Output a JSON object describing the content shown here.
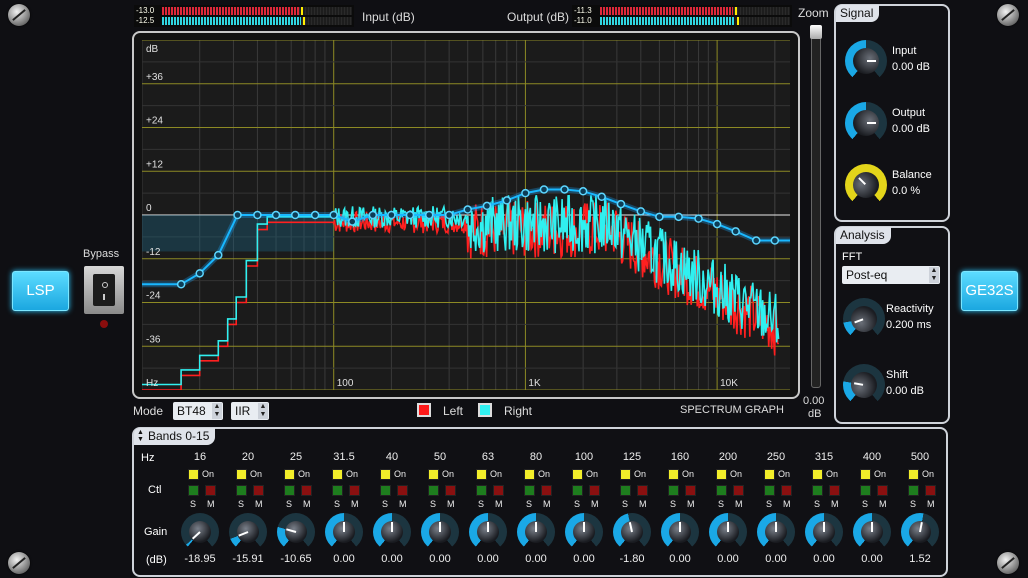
{
  "colors": {
    "accent": "#1ab4f0",
    "graph_bg": "#1a1a1a",
    "curve": "#19b7ff",
    "left": "#ff2020",
    "right": "#30f0f0"
  },
  "buttons": {
    "lsp": "LSP",
    "ge32s": "GE32S"
  },
  "bypass": {
    "label": "Bypass"
  },
  "meters": {
    "input": {
      "label": "Input (dB)",
      "l": "-13.0",
      "r": "-12.5",
      "level_l": 0.72,
      "level_r": 0.73
    },
    "output": {
      "label": "Output (dB)",
      "l": "-11.3",
      "r": "-11.0",
      "level_l": 0.7,
      "level_r": 0.71
    }
  },
  "graph": {
    "db_unit": "dB",
    "hz_unit": "Hz",
    "y_ticks": [
      "+36",
      "+24",
      "+12",
      "0",
      "-12",
      "-24",
      "-36"
    ],
    "x_ticks": [
      "100",
      "1K",
      "10K"
    ],
    "title": "SPECTRUM GRAPH"
  },
  "zoom": {
    "label": "Zoom",
    "value": "0.00",
    "unit": "dB"
  },
  "mode": {
    "label": "Mode",
    "filter": "BT48",
    "type": "IIR"
  },
  "legend": {
    "left": "Left",
    "right": "Right"
  },
  "signal": {
    "title": "Signal",
    "input": {
      "label": "Input",
      "value": "0.00 dB"
    },
    "output": {
      "label": "Output",
      "value": "0.00 dB"
    },
    "balance": {
      "label": "Balance",
      "value": "0.0 %"
    }
  },
  "analysis": {
    "title": "Analysis",
    "fft_label": "FFT",
    "fft_value": "Post-eq",
    "reactivity": {
      "label": "Reactivity",
      "value": "0.200 ms"
    },
    "shift": {
      "label": "Shift",
      "value": "0.00 dB"
    }
  },
  "bands": {
    "title": "Bands 0-15",
    "hz_label": "Hz",
    "ctl_label": "Ctl",
    "gain_label": "Gain",
    "db_label": "(dB)",
    "on_label": "On",
    "s_label": "S",
    "m_label": "M",
    "items": [
      {
        "freq": "16",
        "gain": "-18.95"
      },
      {
        "freq": "20",
        "gain": "-15.91"
      },
      {
        "freq": "25",
        "gain": "-10.65"
      },
      {
        "freq": "31.5",
        "gain": "0.00"
      },
      {
        "freq": "40",
        "gain": "0.00"
      },
      {
        "freq": "50",
        "gain": "0.00"
      },
      {
        "freq": "63",
        "gain": "0.00"
      },
      {
        "freq": "80",
        "gain": "0.00"
      },
      {
        "freq": "100",
        "gain": "0.00"
      },
      {
        "freq": "125",
        "gain": "-1.80"
      },
      {
        "freq": "160",
        "gain": "0.00"
      },
      {
        "freq": "200",
        "gain": "0.00"
      },
      {
        "freq": "250",
        "gain": "0.00"
      },
      {
        "freq": "315",
        "gain": "0.00"
      },
      {
        "freq": "400",
        "gain": "0.00"
      },
      {
        "freq": "500",
        "gain": "1.52"
      }
    ]
  }
}
